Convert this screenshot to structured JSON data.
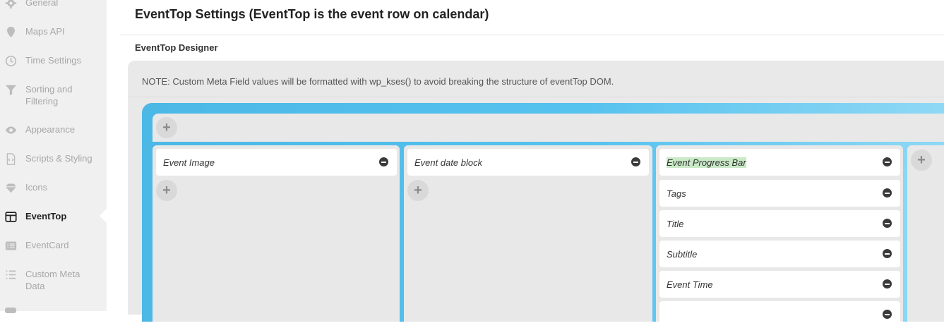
{
  "sidebar": {
    "items": [
      {
        "label": "General",
        "icon": "gear-icon"
      },
      {
        "label": "Maps API",
        "icon": "map-pin-icon"
      },
      {
        "label": "Time Settings",
        "icon": "clock-icon"
      },
      {
        "label": "Sorting and Filtering",
        "icon": "filter-icon"
      },
      {
        "label": "Appearance",
        "icon": "eye-icon"
      },
      {
        "label": "Scripts & Styling",
        "icon": "code-file-icon"
      },
      {
        "label": "Icons",
        "icon": "gem-icon"
      },
      {
        "label": "EventTop",
        "icon": "layout-icon",
        "active": true
      },
      {
        "label": "EventCard",
        "icon": "card-list-icon"
      },
      {
        "label": "Custom Meta Data",
        "icon": "list-icon"
      }
    ]
  },
  "main": {
    "title": "EventTop Settings (EventTop is the event row on calendar)",
    "section_title": "EventTop Designer",
    "note": "NOTE: Custom Meta Field values will be formatted with wp_kses() to avoid breaking the structure of eventTop DOM.",
    "columns": [
      {
        "fields": [
          "Event Image"
        ]
      },
      {
        "fields": [
          "Event date block"
        ]
      },
      {
        "fields": [
          "Event Progress Bar",
          "Tags",
          "Title",
          "Subtitle",
          "Event Time"
        ]
      }
    ]
  },
  "colors": {
    "sidebar_bg": "#f0f0f0",
    "designer_accent": "#4bb8e6",
    "highlight": "#c9e9c7"
  }
}
